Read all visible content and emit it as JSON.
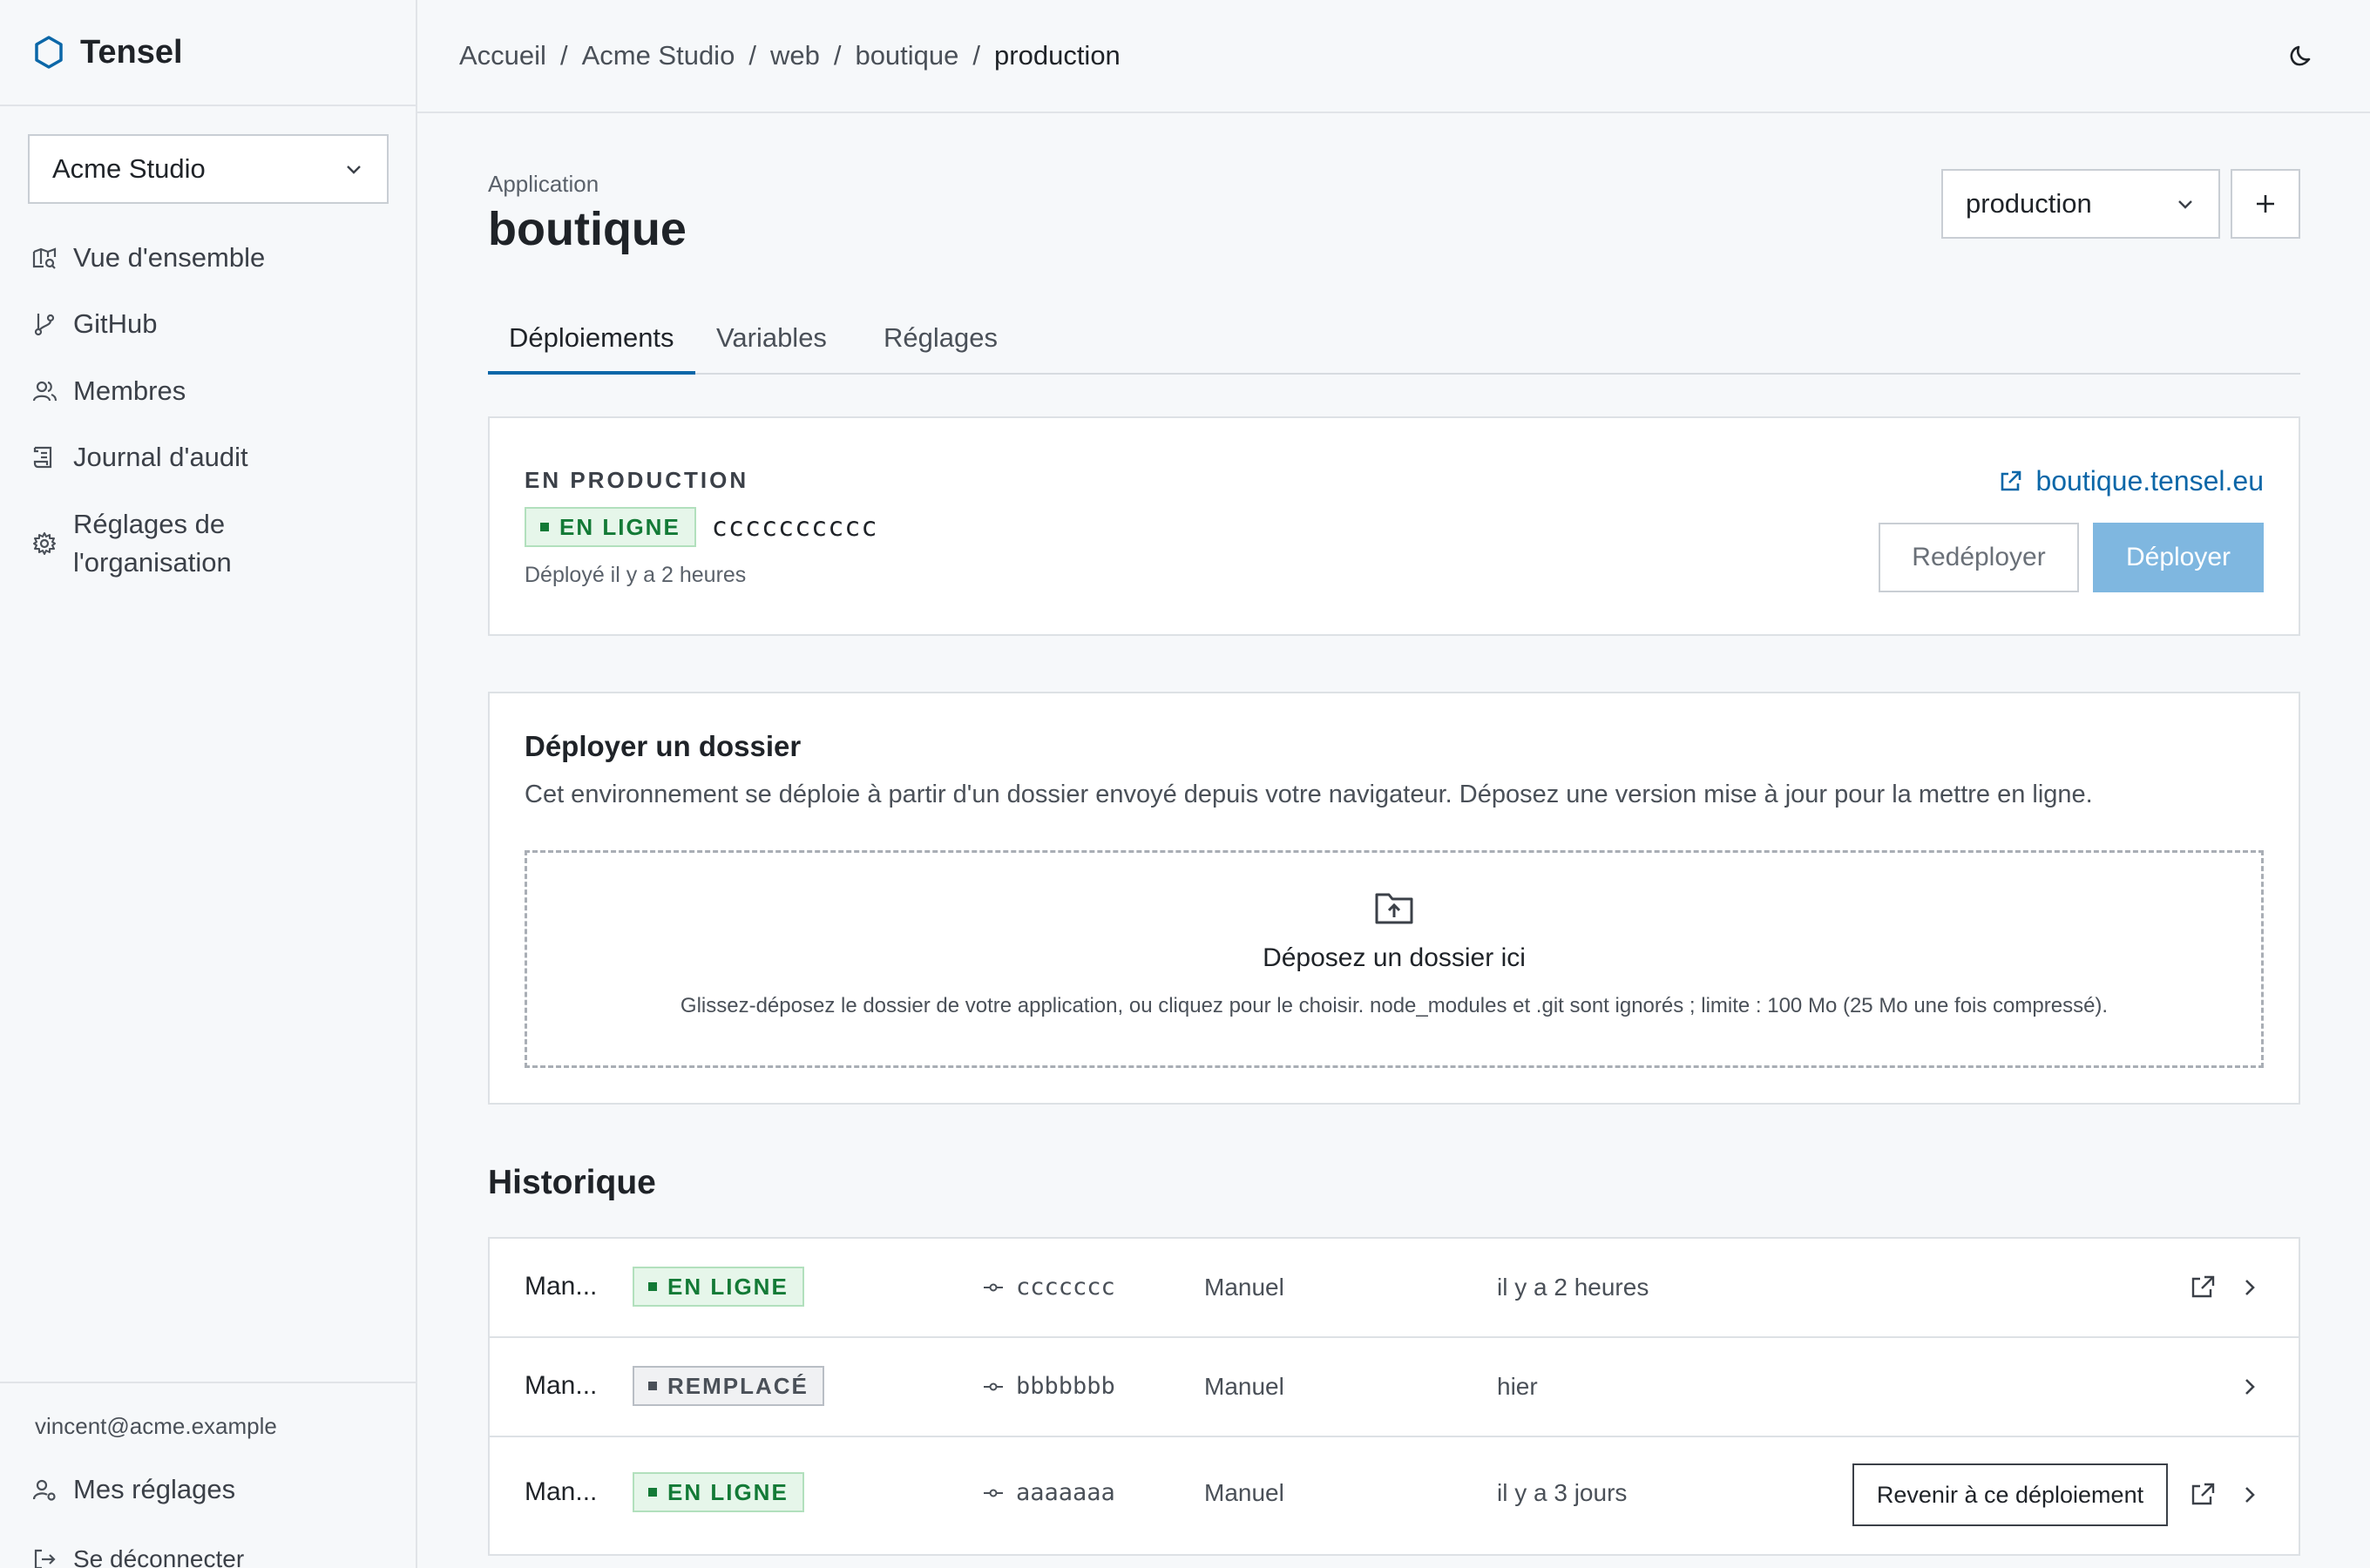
{
  "brand": {
    "name": "Tensel",
    "accent": "#0b67a8"
  },
  "sidebar": {
    "org_selector": {
      "value": "Acme Studio"
    },
    "items": [
      {
        "label": "Vue d'ensemble",
        "icon": "overview-icon"
      },
      {
        "label": "GitHub",
        "icon": "git-branch-icon"
      },
      {
        "label": "Membres",
        "icon": "members-icon"
      },
      {
        "label": "Journal d'audit",
        "icon": "audit-log-icon"
      },
      {
        "label": "Réglages de",
        "label2": "l'organisation",
        "icon": "gear-icon"
      }
    ],
    "user_email": "vincent@acme.example",
    "bottom_items": [
      {
        "label": "Mes réglages",
        "icon": "user-settings-icon"
      },
      {
        "label": "Se déconnecter",
        "icon": "logout-icon"
      }
    ]
  },
  "breadcrumb": [
    "Accueil",
    "Acme Studio",
    "web",
    "boutique",
    "production"
  ],
  "header": {
    "eyebrow": "Application",
    "title": "boutique",
    "environment_selector": {
      "value": "production"
    },
    "add_button": "+"
  },
  "tabs": [
    {
      "label": "Déploiements",
      "active": true
    },
    {
      "label": "Variables",
      "active": false
    },
    {
      "label": "Réglages",
      "active": false
    }
  ],
  "production": {
    "label": "EN PRODUCTION",
    "status": "EN LIGNE",
    "commit": "cccccccccc",
    "deployed": "Déployé il y a 2 heures",
    "url": "boutique.tensel.eu",
    "redeploy_label": "Redéployer",
    "deploy_label": "Déployer"
  },
  "folder_deploy": {
    "title": "Déployer un dossier",
    "description": "Cet environnement se déploie à partir d'un dossier envoyé depuis votre navigateur. Déposez une version mise à jour pour la mettre en ligne.",
    "drop_title": "Déposez un dossier ici",
    "drop_hint": "Glissez-déposez le dossier de votre application, ou cliquez pour le choisir. node_modules et .git sont ignorés ; limite : 100 Mo (25 Mo une fois compressé)."
  },
  "history": {
    "title": "Historique",
    "rows": [
      {
        "name": "Man...",
        "status": "EN LIGNE",
        "status_kind": "live",
        "commit": "ccccccc",
        "source": "Manuel",
        "time": "il y a 2 heures",
        "rollback": "",
        "external": true
      },
      {
        "name": "Man...",
        "status": "REMPLACÉ",
        "status_kind": "replaced",
        "commit": "bbbbbbb",
        "source": "Manuel",
        "time": "hier",
        "rollback": "",
        "external": false
      },
      {
        "name": "Man...",
        "status": "EN LIGNE",
        "status_kind": "live",
        "commit": "aaaaaaa",
        "source": "Manuel",
        "time": "il y a 3 jours",
        "rollback": "Revenir à ce déploiement",
        "external": true
      }
    ]
  }
}
